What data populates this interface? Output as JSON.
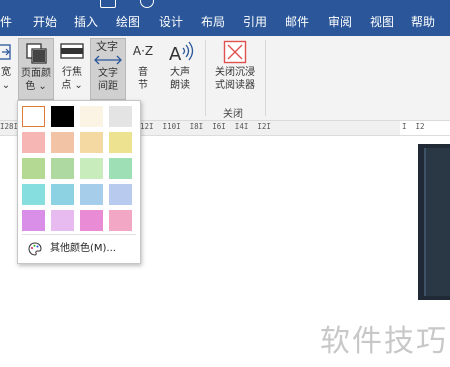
{
  "tabs": [
    "件",
    "开始",
    "插入",
    "绘图",
    "设计",
    "布局",
    "引用",
    "邮件",
    "审阅",
    "视图",
    "帮助"
  ],
  "ribbon": {
    "partial_left": {
      "line1": "宽",
      "line2": "⌄"
    },
    "page_color": {
      "line1": "页面颜",
      "line2": "色 ⌄"
    },
    "line_focus": {
      "line1": "行焦",
      "line2": "点 ⌄"
    },
    "text_spacing": {
      "icon_text": "文字",
      "line1": "文字",
      "line2": "间距"
    },
    "syllables": {
      "icon_text": "A·Z",
      "line1": "音",
      "line2": "节"
    },
    "read_aloud": {
      "line1": "大声",
      "line2": "朗读"
    },
    "close_reader": {
      "line1": "关闭沉浸",
      "line2": "式阅读器"
    },
    "group_close": "关闭"
  },
  "ruler": {
    "left_text": "I28I        I18I  I16I  I14I  I12I  I10I  I8I  I6I  I4I  I2I",
    "right_text": "I  I2"
  },
  "dropdown": {
    "swatch_colors": [
      [
        "#ffffff",
        "#000000",
        "#fbf3e4",
        "#e4e4e4"
      ],
      [
        "#f6b6b4",
        "#f3c3a5",
        "#f5d9a3",
        "#ece28f"
      ],
      [
        "#b4d992",
        "#aed9a0",
        "#c9ecbd",
        "#9edfb6"
      ],
      [
        "#87dede",
        "#8dd2e2",
        "#a6cde9",
        "#b8cbef"
      ],
      [
        "#d98ee8",
        "#e8bbf0",
        "#ea8bd6",
        "#f2a8c4"
      ]
    ],
    "more_colors": "其他颜色(M)..."
  },
  "watermark": "软件技巧",
  "colors": {
    "accent": "#2b579a",
    "close_icon": "#e0504f"
  }
}
